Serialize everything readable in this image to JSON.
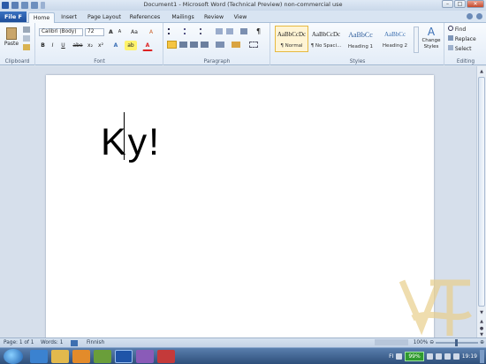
{
  "window": {
    "title": "Document1 - Microsoft Word (Technical Preview) non-commercial use",
    "controls": [
      "–",
      "□",
      "✕"
    ]
  },
  "tabs": {
    "file": "File F",
    "items": [
      "Home",
      "Insert",
      "Page Layout",
      "References",
      "Mailings",
      "Review",
      "View"
    ],
    "active": "Home"
  },
  "ribbon": {
    "clipboard": {
      "label": "Clipboard",
      "paste": "Paste"
    },
    "font": {
      "label": "Font",
      "name": "Calibri (Body)",
      "size": "72",
      "bold": "B",
      "italic": "I",
      "underline": "U",
      "strike": "abe",
      "sub": "x₂",
      "sup": "x²",
      "grow": "A",
      "shrink": "A",
      "case": "Aa",
      "clear": "A",
      "highlight": "ab",
      "color": "A"
    },
    "paragraph": {
      "label": "Paragraph"
    },
    "styles": {
      "label": "Styles",
      "items": [
        {
          "preview": "AaBbCcDc",
          "name": "¶ Normal"
        },
        {
          "preview": "AaBbCcDc",
          "name": "¶ No Spaci..."
        },
        {
          "preview": "AaBbCc",
          "name": "Heading 1"
        },
        {
          "preview": "AaBbCc",
          "name": "Heading 2"
        }
      ],
      "change": "Change Styles"
    },
    "editing": {
      "label": "Editing",
      "find": "Find",
      "replace": "Replace",
      "select": "Select"
    }
  },
  "document": {
    "text": "Ky!"
  },
  "status": {
    "page": "Page: 1 of 1",
    "words": "Words: 1",
    "language": "Finnish",
    "zoom": "100%"
  },
  "taskbar": {
    "battery": "99%",
    "language": "FI",
    "time": "19:19"
  }
}
